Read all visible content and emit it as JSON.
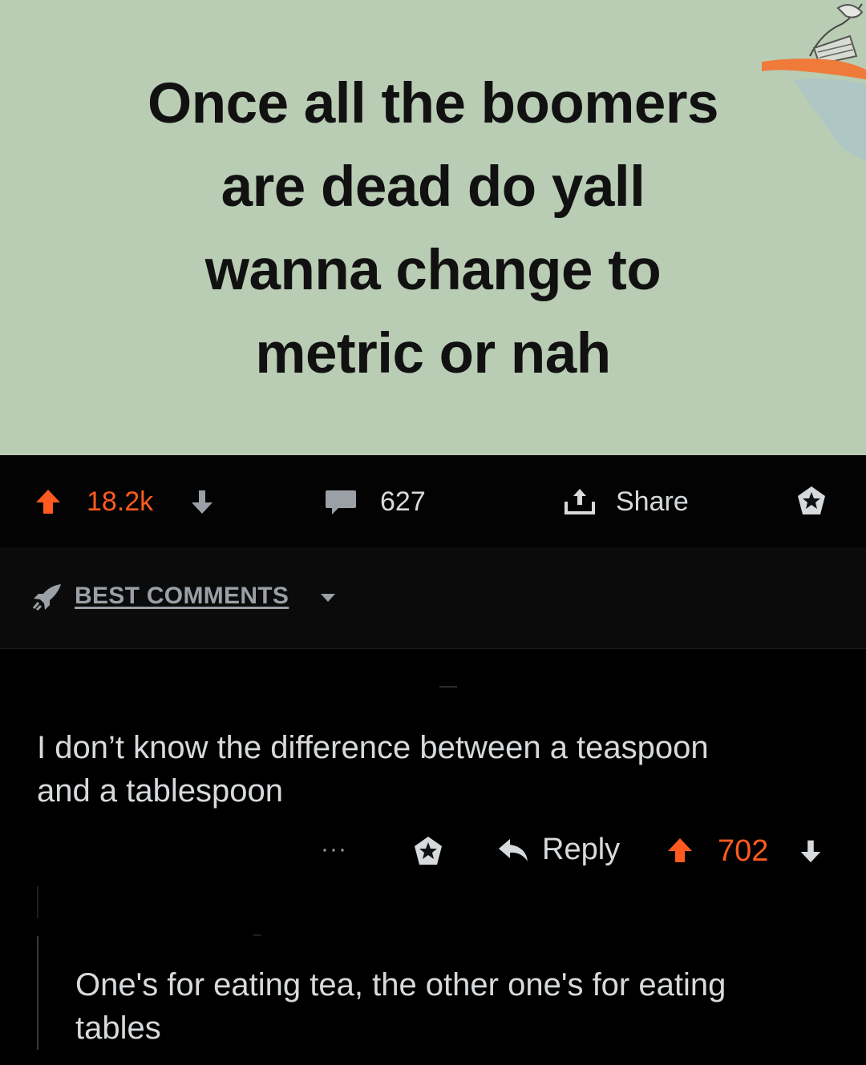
{
  "post": {
    "title_lines": [
      "Once all the boomers",
      "are dead do yall",
      "wanna change to",
      "metric or nah"
    ],
    "background_color": "#b9ccb4",
    "upvotes": "18.2k",
    "comments": "627",
    "share_label": "Share"
  },
  "sort": {
    "label": "BEST COMMENTS"
  },
  "comments": [
    {
      "body": "I don’t know the difference between a teaspoon and a tablespoon",
      "more_label": "···",
      "reply_label": "Reply",
      "votes": "702"
    },
    {
      "body": "One's for eating tea, the other one's for eating tables"
    }
  ],
  "colors": {
    "upvote": "#ff5a1f",
    "text": "#d7dadc",
    "muted": "#9aa0a6",
    "background": "#000000"
  },
  "icons": {
    "upvote": "arrow-up-icon",
    "downvote": "arrow-down-icon",
    "comment": "speech-bubble-icon",
    "share": "share-upload-icon",
    "award": "award-star-icon",
    "sort": "rocket-icon",
    "reply": "reply-arrow-icon",
    "more": "more-dots-icon"
  }
}
